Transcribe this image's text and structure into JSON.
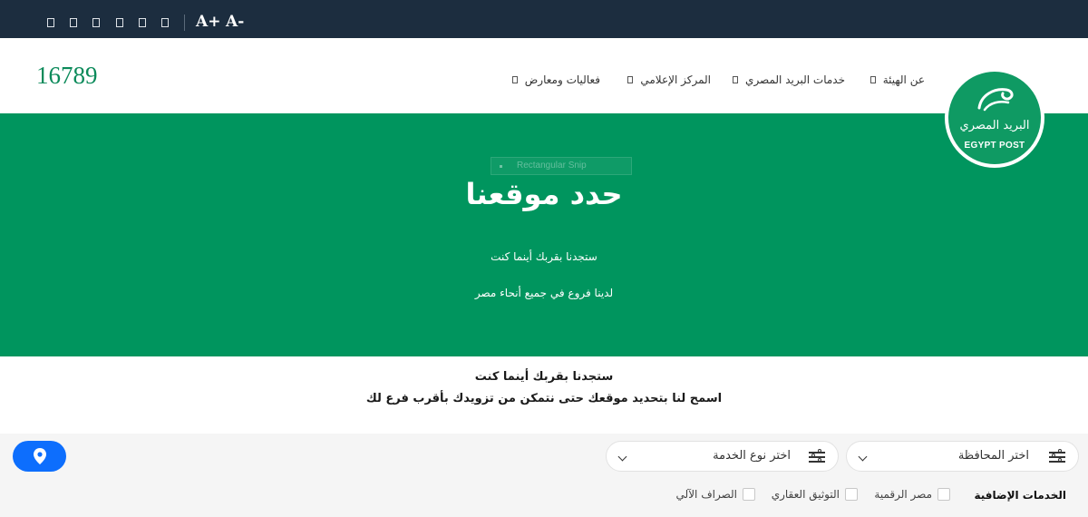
{
  "topbar": {
    "font_increase": "A+",
    "font_decrease": "A-",
    "social_icons": [
      "icon-1",
      "icon-2",
      "icon-3",
      "icon-4",
      "icon-5",
      "icon-6"
    ]
  },
  "header": {
    "hotline": "16789",
    "nav": [
      {
        "label": "عن الهيئة"
      },
      {
        "label": "خدمات البريد المصري"
      },
      {
        "label": "المركز الإعلامي"
      },
      {
        "label": "فعاليات ومعارض"
      }
    ],
    "logo": {
      "arabic": "البريد المصري",
      "latin": "EGYPT POST"
    }
  },
  "hero": {
    "overlay_label": "Rectangular Snip",
    "title": "حدد موقعنا",
    "line1": "ستجدنا بقربك أينما كنت",
    "line2": "لدينا فروع في جميع أنحاء مصر"
  },
  "intro": {
    "line1": "ستجدنا بقربك أينما كنت",
    "line2": "اسمح لنا بتحديد موقعك حتى نتمكن من تزويدك بأقرب فرع لك"
  },
  "filter": {
    "governorate_placeholder": "اختر المحافظة",
    "service_placeholder": "اختر نوع الخدمة",
    "extra_services_label": "الخدمات الإضافية",
    "checkboxes": [
      {
        "label": "مصر الرقمية"
      },
      {
        "label": "التوثيق العقاري"
      },
      {
        "label": "الصراف الآلي"
      }
    ]
  },
  "colors": {
    "topbar": "#1c2d3f",
    "brand_green": "#00955e",
    "hotline_green": "#0b8a5a",
    "location_button": "#0d6efd"
  }
}
